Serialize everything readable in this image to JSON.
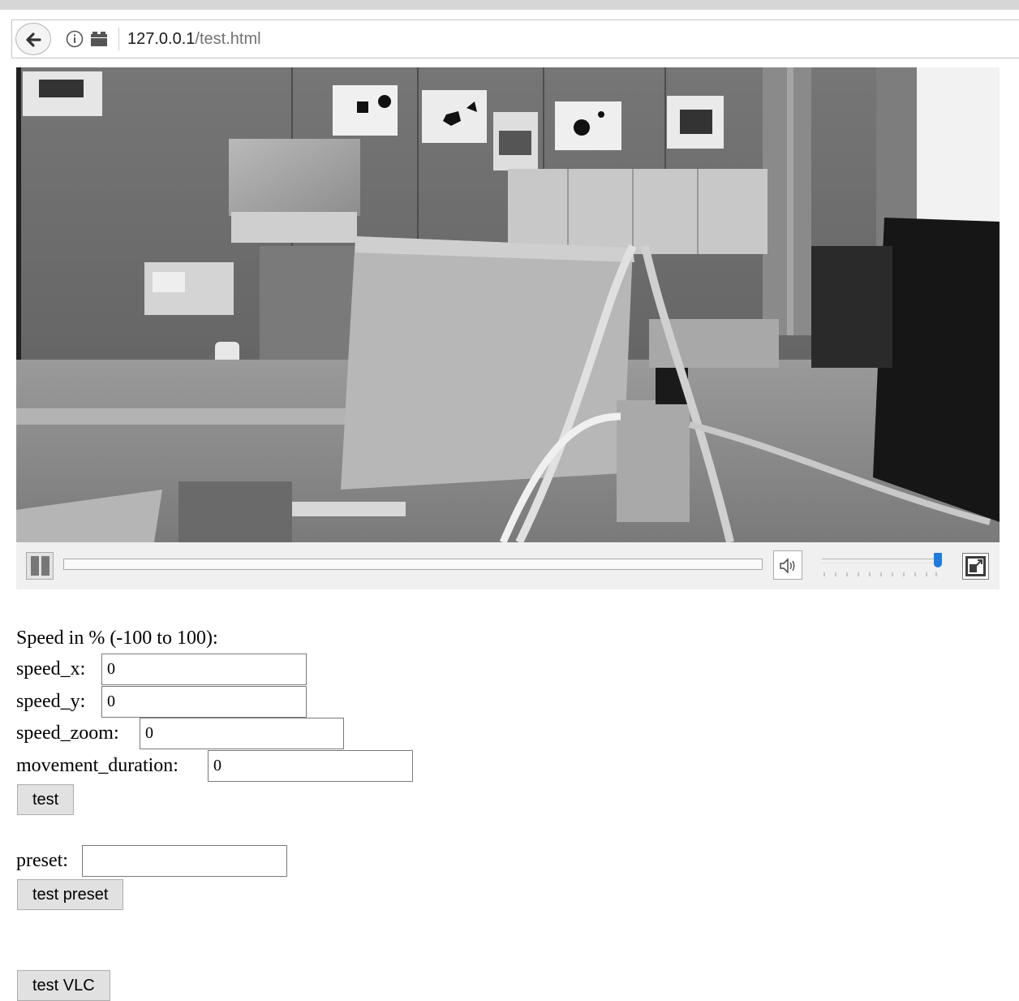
{
  "browser": {
    "url_host": "127.0.0.1",
    "url_path": "/test.html",
    "icons": {
      "back": "back-arrow-icon",
      "info": "info-icon",
      "page": "page-icon"
    }
  },
  "video": {
    "description": "live grayscale camera feed",
    "controls": {
      "play_state": "playing",
      "progress": 0,
      "volume": 1.0,
      "icons": {
        "pause": "pause-icon",
        "volume": "speaker-icon",
        "fullscreen": "fullscreen-icon"
      },
      "accent_color": "#1e7be0"
    }
  },
  "form": {
    "heading": "Speed in % (-100 to 100):",
    "fields": [
      {
        "label": "speed_x:",
        "value": "0"
      },
      {
        "label": "speed_y:",
        "value": "0"
      },
      {
        "label": "speed_zoom:",
        "value": "0"
      },
      {
        "label": "movement_duration:",
        "value": "0"
      }
    ],
    "test_button": "test",
    "preset": {
      "label": "preset:",
      "value": ""
    },
    "test_preset_button": "test preset",
    "test_vlc_button": "test VLC"
  }
}
